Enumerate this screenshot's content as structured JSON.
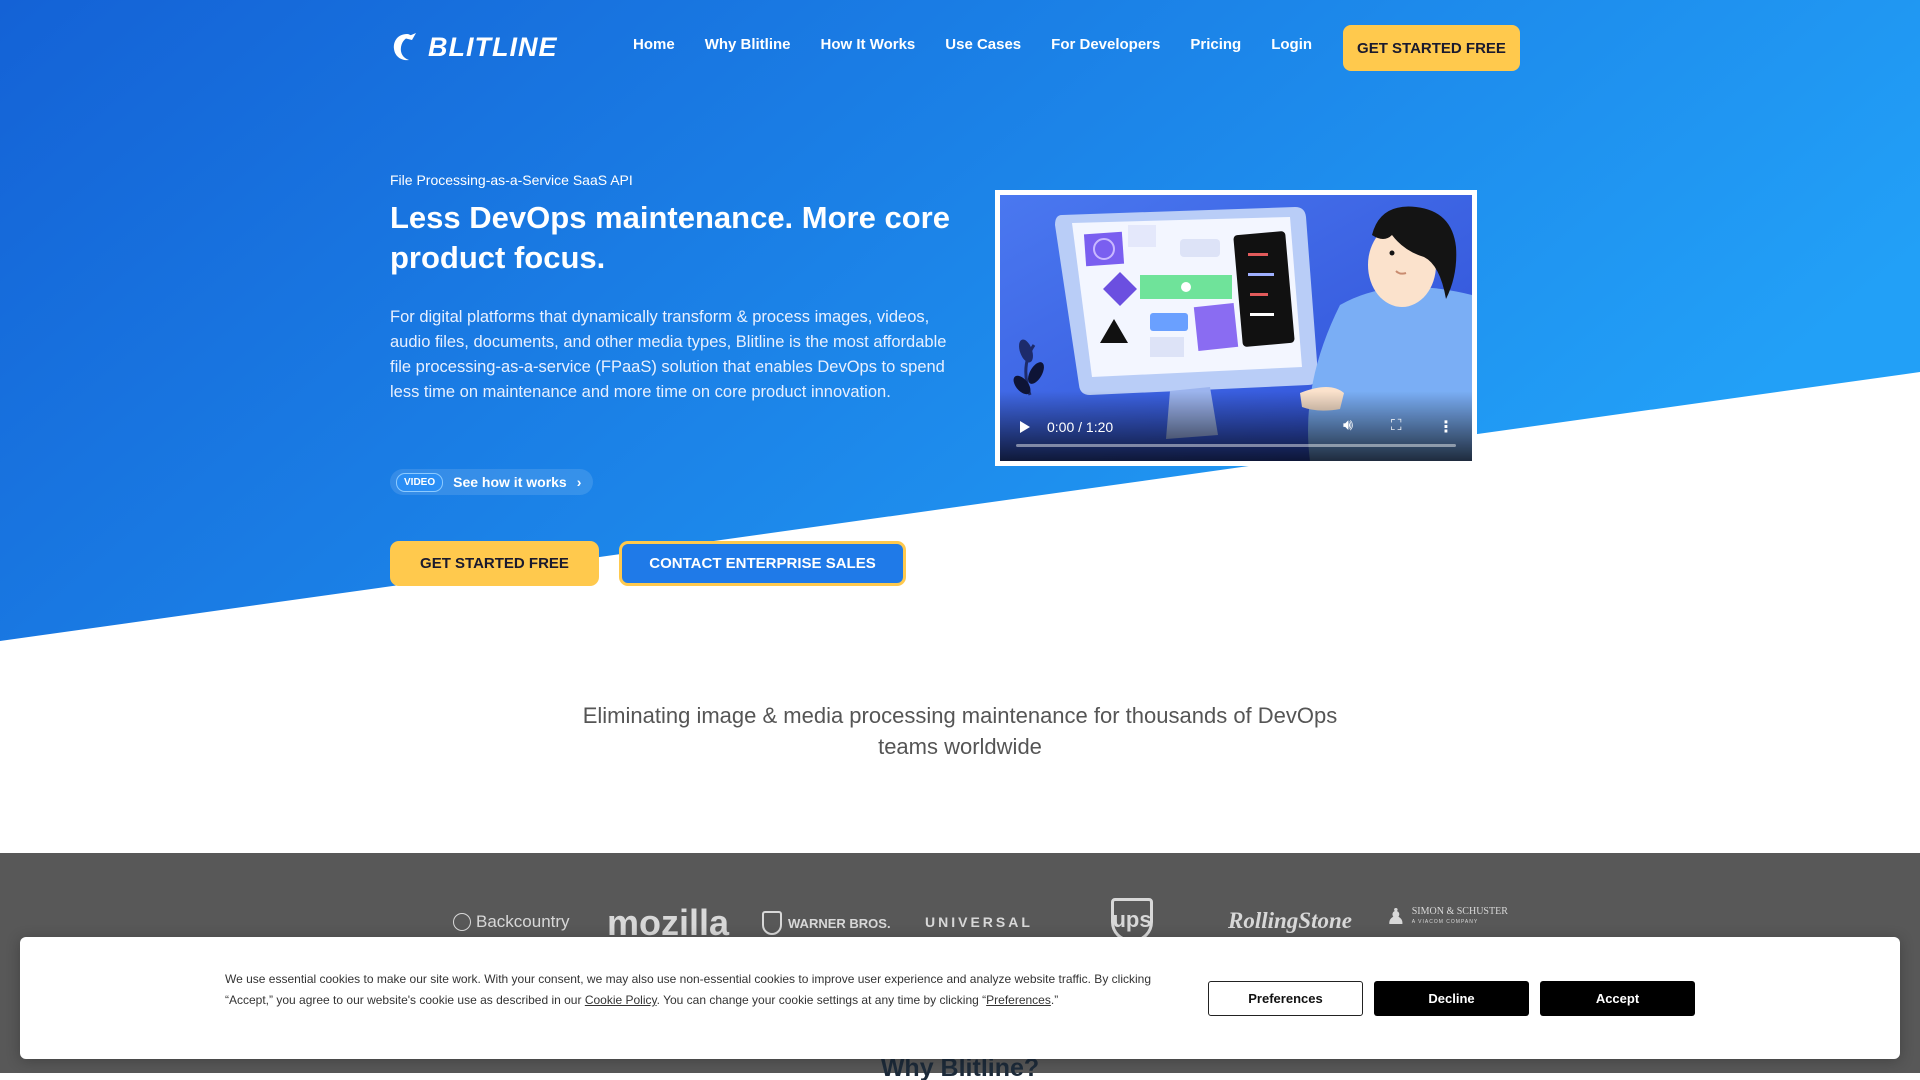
{
  "header": {
    "logo_text": "BLITLINE",
    "nav": [
      "Home",
      "Why Blitline",
      "How It Works",
      "Use Cases",
      "For Developers",
      "Pricing",
      "Login"
    ],
    "cta": "GET STARTED FREE"
  },
  "hero": {
    "eyebrow": "File Processing-as-a-Service SaaS API",
    "headline": "Less DevOps maintenance. More core product focus.",
    "description": "For digital platforms that dynamically transform & process images, videos, audio files, documents, and other media types, Blitline is the most affordable file processing-as-a-service (FPaaS) solution that enables DevOps to spend less time on maintenance and more time on core product innovation.",
    "video_badge": "VIDEO",
    "video_link": "See how it works",
    "primary_cta": "GET STARTED FREE",
    "secondary_cta": "CONTACT ENTERPRISE SALES"
  },
  "video": {
    "time": "0:00 / 1:20",
    "progress": 0
  },
  "tagline": "Eliminating image & media processing maintenance for thousands of DevOps teams worldwide",
  "client_logos": [
    "Backcountry",
    "mozilla",
    "WARNER BROS.",
    "UNIVERSAL",
    "ups",
    "RollingStone",
    "SIMON & SCHUSTER"
  ],
  "client_logo_subtext": "A VIACOM COMPANY",
  "cookie": {
    "text_1": "We use essential cookies to make our site work. With your consent, we may also use non-essential cookies to improve user experience and analyze website traffic. By clicking “Accept,” you agree to our website's cookie use as described in our ",
    "policy_link": "Cookie Policy",
    "text_2": ". You can change your cookie settings at any time by clicking “",
    "pref_link": "Preferences",
    "text_3": ".”",
    "preferences": "Preferences",
    "decline": "Decline",
    "accept": "Accept"
  },
  "next_section_title": "Why Blitline?",
  "colors": {
    "hero_start": "#1565d8",
    "hero_end": "#1f9bf5",
    "accent_yellow": "#ffc94d",
    "logos_band": "#585858"
  }
}
